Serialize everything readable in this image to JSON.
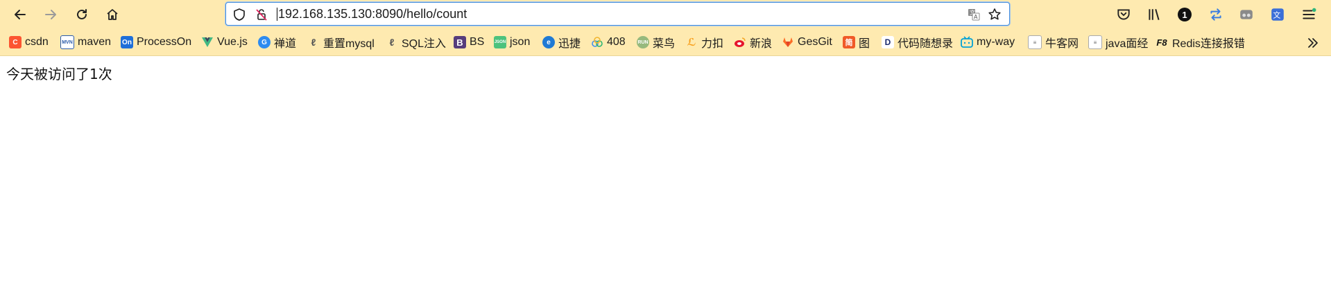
{
  "browser": {
    "url": "192.168.135.130:8090/hello/count",
    "account_badge": "1",
    "colors": {
      "toolbar": "#feeab0",
      "focus_ring": "#4a90d9"
    }
  },
  "bookmarks": [
    {
      "label": "csdn",
      "icon": "csdn-icon"
    },
    {
      "label": "maven",
      "icon": "maven-icon"
    },
    {
      "label": "ProcessOn",
      "icon": "processon-icon"
    },
    {
      "label": "Vue.js",
      "icon": "vue-icon"
    },
    {
      "label": "禅道",
      "icon": "zentao-icon"
    },
    {
      "label": "重置mysql",
      "icon": "doc-icon"
    },
    {
      "label": "SQL注入",
      "icon": "doc-icon"
    },
    {
      "label": "BS",
      "icon": "bootstrap-icon"
    },
    {
      "label": "json",
      "icon": "json-icon"
    },
    {
      "label": "迅捷",
      "icon": "xunjie-icon"
    },
    {
      "label": "408",
      "icon": "cloud-icon"
    },
    {
      "label": "菜鸟",
      "icon": "runoob-icon"
    },
    {
      "label": "力扣",
      "icon": "leetcode-icon"
    },
    {
      "label": "新浪",
      "icon": "weibo-icon"
    },
    {
      "label": "GesGit",
      "icon": "gitlab-icon"
    },
    {
      "label": "图",
      "icon": "jian-icon"
    },
    {
      "label": "代码随想录",
      "icon": "dm-icon"
    },
    {
      "label": "my-way",
      "icon": "bilibili-icon"
    },
    {
      "label": "牛客网",
      "icon": "page-icon"
    },
    {
      "label": "java面经",
      "icon": "page-icon"
    },
    {
      "label": "Redis连接报错",
      "icon": "f8-icon"
    }
  ],
  "page": {
    "message": "今天被访问了1次"
  }
}
